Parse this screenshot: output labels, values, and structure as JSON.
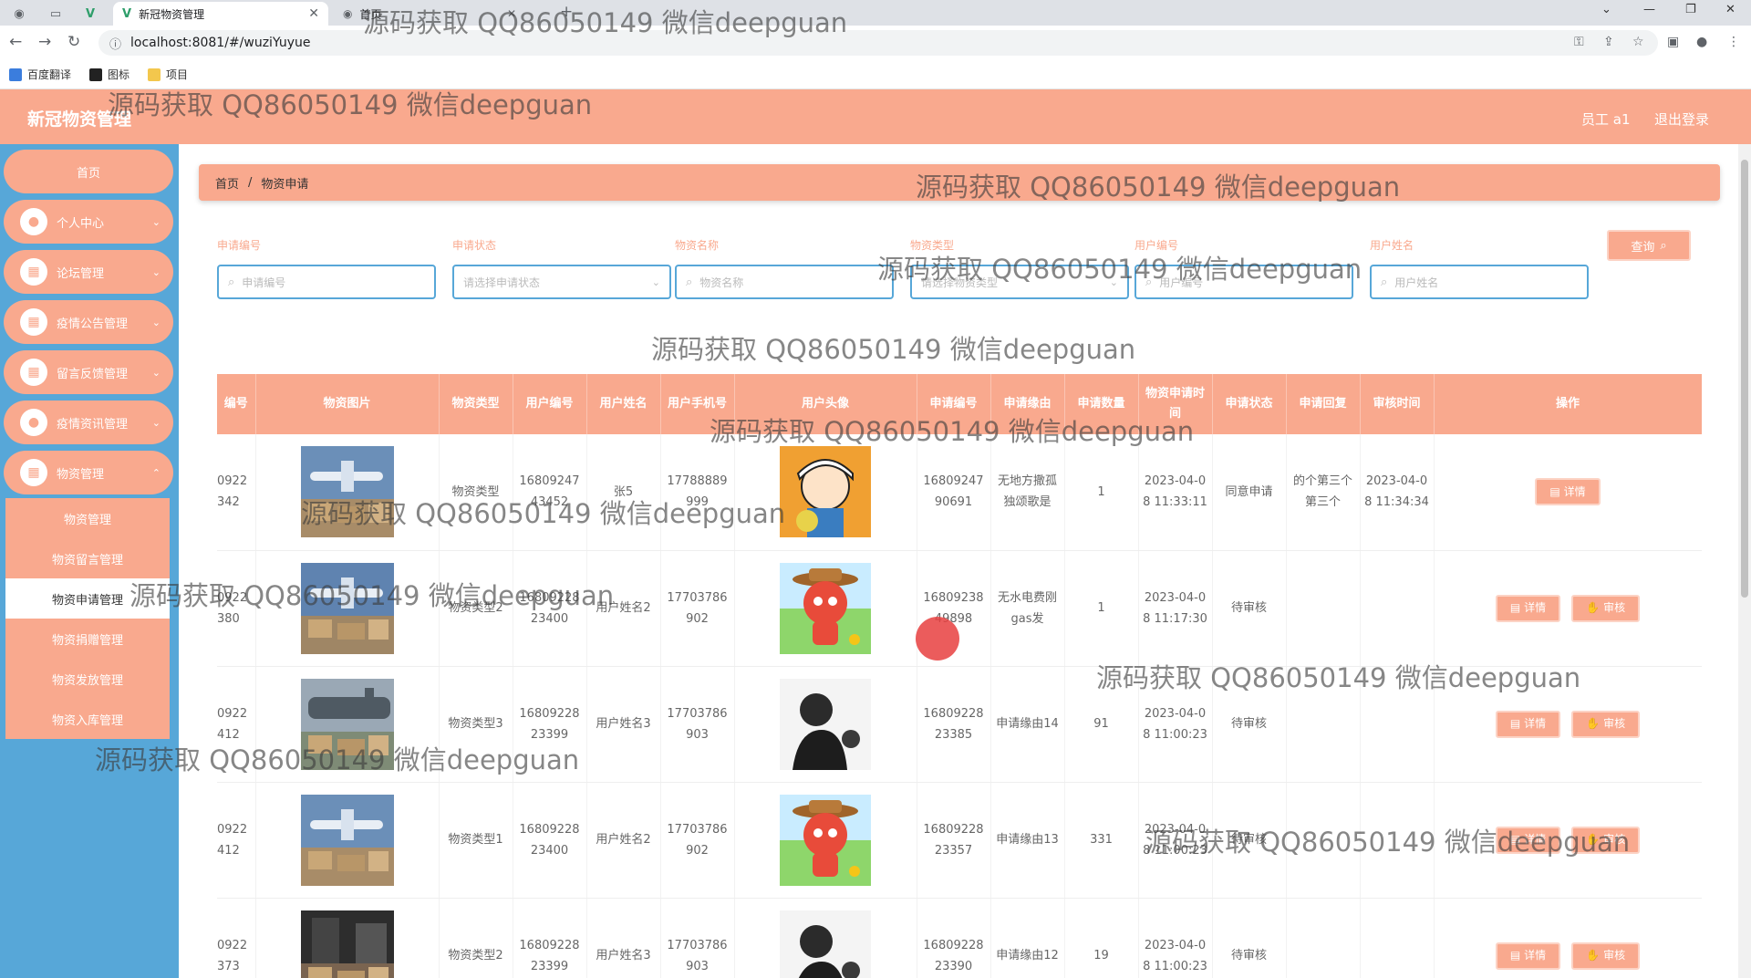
{
  "browser": {
    "active_tab_title": "新冠物资管理",
    "second_tab_title": "首页",
    "url": "localhost:8081/#/wuziYuyue",
    "bookmarks": [
      "百度翻译",
      "图标",
      "项目"
    ]
  },
  "header": {
    "app_title": "新冠物资管理",
    "user_label": "员工 a1",
    "logout_label": "退出登录"
  },
  "sidebar": {
    "home": "首页",
    "menus": [
      "个人中心",
      "论坛管理",
      "疫情公告管理",
      "留言反馈管理",
      "疫情资讯管理",
      "物资管理"
    ],
    "submenus": [
      "物资管理",
      "物资留言管理",
      "物资申请管理",
      "物资捐赠管理",
      "物资发放管理",
      "物资入库管理"
    ]
  },
  "breadcrumb": {
    "home": "首页",
    "current": "物资申请"
  },
  "filters": {
    "labels": [
      "申请编号",
      "申请状态",
      "物资名称",
      "物资类型",
      "用户编号",
      "用户姓名"
    ],
    "placeholders": [
      "申请编号",
      "请选择申请状态",
      "物资名称",
      "请选择物资类型",
      "用户编号",
      "用户姓名"
    ],
    "query_button": "查询"
  },
  "table": {
    "headers": [
      "编号",
      "物资图片",
      "物资类型",
      "用户编号",
      "用户姓名",
      "用户手机号",
      "用户头像",
      "申请编号",
      "申请缘由",
      "申请数量",
      "物资申请时间",
      "申请状态",
      "申请回复",
      "审核时间",
      "操作"
    ],
    "rows": [
      {
        "no": "0922342",
        "type": "物资类型",
        "user_no": "1680924743452",
        "user_name": "张5",
        "phone": "17788889999",
        "apply_no": "1680924790691",
        "reason": "无地方撒孤独颂歌是",
        "qty": "1",
        "apply_time": "2023-04-08 11:33:11",
        "status": "同意申请",
        "reply": "的个第三个第三个",
        "audit_time": "2023-04-08 11:34:34",
        "ops": [
          "详情"
        ]
      },
      {
        "no": "0922380",
        "type": "物资类型2",
        "user_no": "1680922823400",
        "user_name": "用户姓名2",
        "phone": "17703786902",
        "apply_no": "1680923849898",
        "reason": "无水电费刚gas发",
        "qty": "1",
        "apply_time": "2023-04-08 11:17:30",
        "status": "待审核",
        "reply": "",
        "audit_time": "",
        "ops": [
          "详情",
          "审核"
        ]
      },
      {
        "no": "0922412",
        "type": "物资类型3",
        "user_no": "1680922823399",
        "user_name": "用户姓名3",
        "phone": "17703786903",
        "apply_no": "1680922823385",
        "reason": "申请缘由14",
        "qty": "91",
        "apply_time": "2023-04-08 11:00:23",
        "status": "待审核",
        "reply": "",
        "audit_time": "",
        "ops": [
          "详情",
          "审核"
        ]
      },
      {
        "no": "0922412",
        "type": "物资类型1",
        "user_no": "1680922823400",
        "user_name": "用户姓名2",
        "phone": "17703786902",
        "apply_no": "1680922823357",
        "reason": "申请缘由13",
        "qty": "331",
        "apply_time": "2023-04-08 11:00:23",
        "status": "待审核",
        "reply": "",
        "audit_time": "",
        "ops": [
          "详情",
          "审核"
        ]
      },
      {
        "no": "0922373",
        "type": "物资类型2",
        "user_no": "1680922823399",
        "user_name": "用户姓名3",
        "phone": "17703786903",
        "apply_no": "1680922823390",
        "reason": "申请缘由12",
        "qty": "19",
        "apply_time": "2023-04-08 11:00:23",
        "status": "待审核",
        "reply": "",
        "audit_time": "",
        "ops": [
          "详情",
          "审核"
        ]
      }
    ]
  },
  "watermark": "源码获取 QQ86050149 微信deepguan",
  "colors": {
    "accent": "#f9a98e",
    "sidebar": "#57a7d8",
    "header_text": "#ffffff"
  }
}
